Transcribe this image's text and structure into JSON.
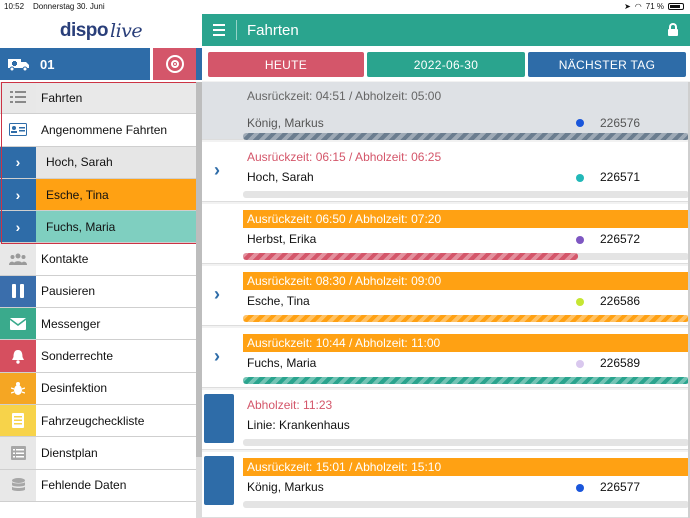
{
  "status": {
    "time": "10:52",
    "date": "Donnerstag 30. Juni",
    "battery": "71 %"
  },
  "logo": {
    "part1": "dispo",
    "part2": "live"
  },
  "vehicle": {
    "number": "01"
  },
  "menu": [
    {
      "label": "Fahrten",
      "icon": "list-icon"
    },
    {
      "label": "Angenommene Fahrten",
      "icon": "id-card-icon"
    },
    {
      "label": "Hoch, Sarah",
      "icon": "chevron-right-icon"
    },
    {
      "label": "Esche, Tina",
      "icon": "chevron-right-icon"
    },
    {
      "label": "Fuchs, Maria",
      "icon": "chevron-right-icon"
    },
    {
      "label": "Kontakte",
      "icon": "people-icon"
    },
    {
      "label": "Pausieren",
      "icon": "pause-icon"
    },
    {
      "label": "Messenger",
      "icon": "envelope-icon"
    },
    {
      "label": "Sonderrechte",
      "icon": "bell-icon"
    },
    {
      "label": "Desinfektion",
      "icon": "bug-icon"
    },
    {
      "label": "Fahrzeugcheckliste",
      "icon": "checklist-icon"
    },
    {
      "label": "Dienstplan",
      "icon": "calendar-list-icon"
    },
    {
      "label": "Fehlende Daten",
      "icon": "database-icon"
    }
  ],
  "header": {
    "title": "Fahrten"
  },
  "tabs": {
    "today": "HEUTE",
    "date": "2022-06-30",
    "next": "NÄCHSTER TAG"
  },
  "trips": [
    {
      "time": "Ausrückzeit: 04:51 / Abholzeit: 05:00",
      "name": "König, Markus",
      "number": "226576",
      "dot": "#1a56db",
      "progress": 1.0
    },
    {
      "time": "Ausrückzeit: 06:15 / Abholzeit: 06:25",
      "name": "Hoch, Sarah",
      "number": "226571",
      "dot": "#22b8b8",
      "progress": 0
    },
    {
      "time": "Ausrückzeit: 06:50 / Abholzeit: 07:20",
      "name": "Herbst, Erika",
      "number": "226572",
      "dot": "#7e57c2",
      "progress": 0.75
    },
    {
      "time": "Ausrückzeit: 08:30 / Abholzeit: 09:00",
      "name": "Esche, Tina",
      "number": "226586",
      "dot": "#c6e633",
      "progress": 1.0
    },
    {
      "time": "Ausrückzeit: 10:44 / Abholzeit: 11:00",
      "name": "Fuchs, Maria",
      "number": "226589",
      "dot": "#d9c8ee",
      "progress": 1.0
    },
    {
      "time": "Abholzeit: 11:23",
      "name": "Linie: Krankenhaus",
      "number": "",
      "dot": "",
      "progress": 0
    },
    {
      "time": "Ausrückzeit: 15:01 / Abholzeit: 15:10",
      "name": "König, Markus",
      "number": "226577",
      "dot": "#1a56db",
      "progress": 0
    }
  ]
}
